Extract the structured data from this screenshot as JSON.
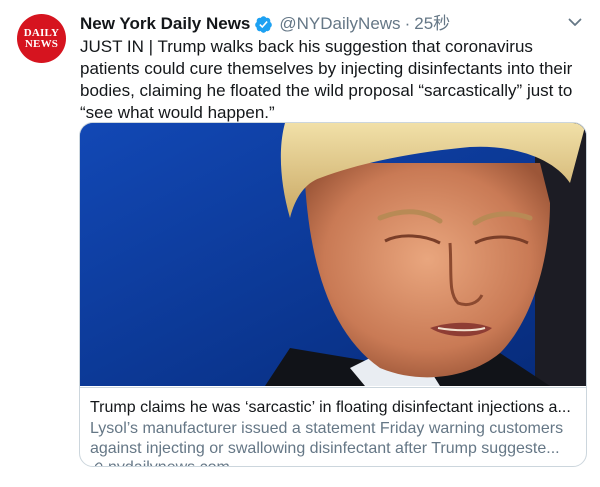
{
  "account": {
    "display_name": "New York Daily News",
    "handle": "@NYDailyNews",
    "separator": "·",
    "timestamp": "25秒",
    "avatar_text_line1": "DAILY",
    "avatar_text_line2": "NEWS"
  },
  "tweet": {
    "text": "JUST IN | Trump walks back his suggestion that coronavirus patients could cure themselves by injecting disinfectants into their bodies, claiming he floated the wild proposal “sarcastically” just to “see what would happen.”"
  },
  "card": {
    "title": "Trump claims he was ‘sarcastic’ in floating disinfectant injections a...",
    "description": "Lysol’s manufacturer issued a statement Friday warning customers against injecting or swallowing disinfectant after Trump suggeste...",
    "domain": "nydailynews.com"
  },
  "icons": {
    "verified": "verified-badge-icon",
    "menu": "chevron-down-icon",
    "link": "link-icon"
  },
  "colors": {
    "brand_red": "#d6141f",
    "verified_blue": "#1da1f2",
    "secondary_text": "#657786",
    "border": "#ccd6dd",
    "photo_background": "#0d3fa6"
  }
}
